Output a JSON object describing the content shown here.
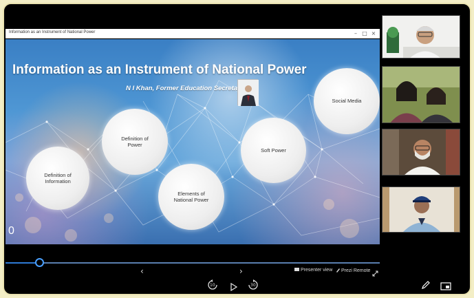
{
  "window": {
    "title": "Information as an Instrument of National Power",
    "minimize": "–",
    "maximize": "□",
    "close": "×"
  },
  "slide": {
    "title": "Information as an Instrument of National Power",
    "subtitle": "N I Khan, Former Education Secretary",
    "slide_number": "0",
    "topics": [
      {
        "label": "Definition of Information"
      },
      {
        "label": "Definition of Power"
      },
      {
        "label": "Elements of National Power"
      },
      {
        "label": "Soft Power"
      },
      {
        "label": "Social Media"
      }
    ]
  },
  "controls": {
    "progress": 0.09,
    "prev_icon": "‹",
    "next_icon": "›",
    "presenter_view": "Presenter view",
    "prezi_remote": "Prezi Remote",
    "rewind_label": "10",
    "forward_label": "30"
  },
  "icons": {
    "expand": "expand-icon",
    "pen": "pen-icon",
    "screen": "screen-icon",
    "play": "play-icon"
  },
  "colors": {
    "accent": "#4aa0ff",
    "background": "#000000",
    "frame_border": "#e9e2b0"
  }
}
